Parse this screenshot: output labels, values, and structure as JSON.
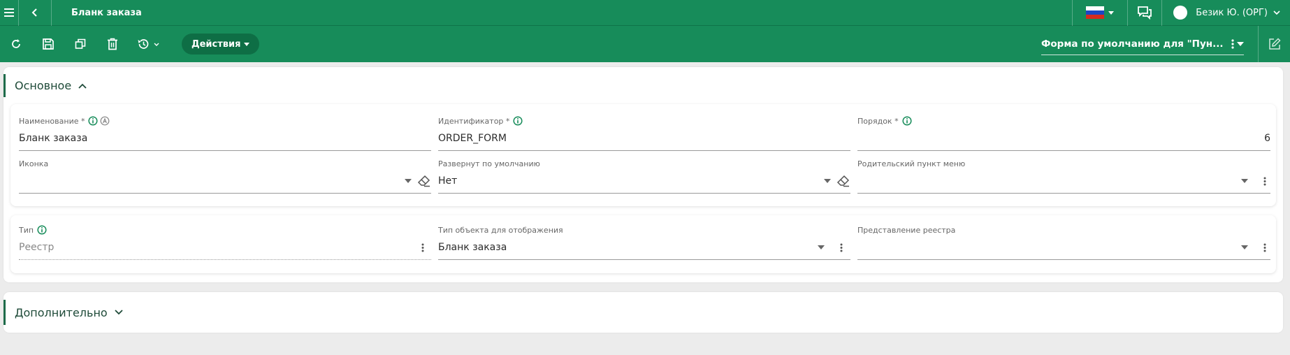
{
  "app": {
    "title": "Бланк заказа"
  },
  "header": {
    "language": "ru",
    "user": "Безик Ю. (ОРГ)",
    "accent": "#178c5a"
  },
  "toolbar": {
    "actions_label": "Действия",
    "form_selector": "Форма по умолчанию для \"Пун..."
  },
  "sections": {
    "main": {
      "title": "Основное"
    },
    "extra": {
      "title": "Дополнительно"
    }
  },
  "fields": {
    "name": {
      "label": "Наименование *",
      "value": "Бланк заказа"
    },
    "identifier": {
      "label": "Идентификатор *",
      "value": "ORDER_FORM"
    },
    "order": {
      "label": "Порядок *",
      "value": "6"
    },
    "icon": {
      "label": "Иконка",
      "value": ""
    },
    "expanded": {
      "label": "Развернут по умолчанию",
      "value": "Нет"
    },
    "parent_menu": {
      "label": "Родительский пункт меню",
      "value": ""
    },
    "type": {
      "label": "Тип",
      "value": "Реестр"
    },
    "object_type": {
      "label": "Тип объекта для отображения",
      "value": "Бланк заказа"
    },
    "registry_view": {
      "label": "Представление реестра",
      "value": ""
    }
  }
}
